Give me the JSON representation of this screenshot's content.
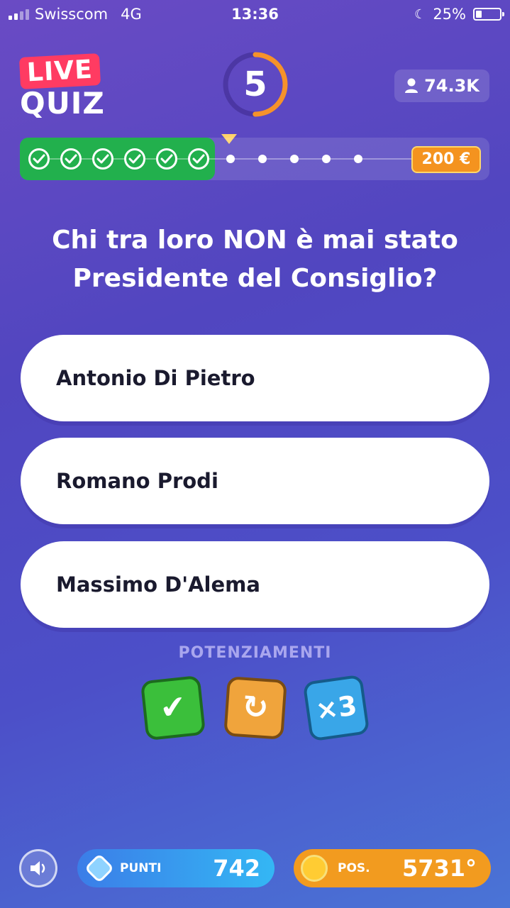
{
  "status_bar": {
    "carrier": "Swisscom",
    "network": "4G",
    "time": "13:36",
    "battery": "25%",
    "battery_level": 0.25
  },
  "header": {
    "logo_live": "LIVE",
    "logo_quiz": "QUIZ",
    "countdown": "5",
    "countdown_fraction_remaining": 0.5,
    "viewers": "74.3K"
  },
  "progress": {
    "completed_steps": 6,
    "total_steps": 12,
    "prize": "200 €"
  },
  "question": "Chi tra loro NON è mai stato Presidente del Consiglio?",
  "answers": [
    {
      "label": "Antonio Di Pietro"
    },
    {
      "label": "Romano Prodi"
    },
    {
      "label": "Massimo D'Alema"
    }
  ],
  "powerups": {
    "title": "POTENZIAMENTI",
    "items": [
      {
        "name": "correct-answer",
        "glyph": "✔",
        "color": "#3bbf3b"
      },
      {
        "name": "refresh-question",
        "glyph": "↻",
        "color": "#f0a43c"
      },
      {
        "name": "times-three",
        "glyph": "×3",
        "color": "#39a6e8"
      }
    ]
  },
  "bottom": {
    "points_label": "PUNTI",
    "points_value": "742",
    "position_label": "POS.",
    "position_value": "5731°"
  },
  "colors": {
    "accent_green": "#22b04d",
    "live_red": "#ff3b62",
    "timer_orange": "#f6922a",
    "prize_orange": "#f4931f"
  }
}
